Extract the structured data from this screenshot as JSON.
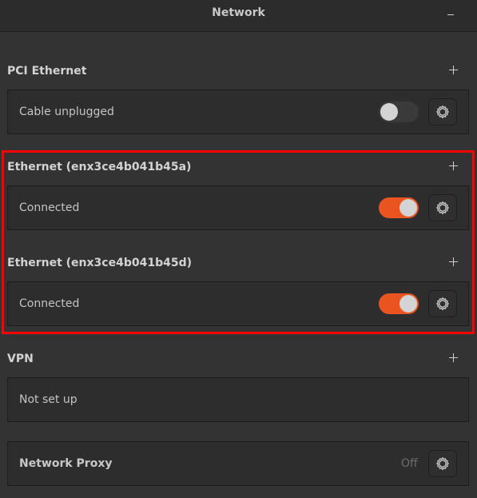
{
  "window": {
    "title": "Network",
    "minimize_icon": "minimize-icon"
  },
  "sections": [
    {
      "title": "PCI Ethernet",
      "add_icon": "plus-icon",
      "row": {
        "label": "Cable unplugged",
        "switch_on": false,
        "settings_icon": "gear-icon"
      }
    },
    {
      "title": "Ethernet (enx3ce4b041b45a)",
      "add_icon": "plus-icon",
      "row": {
        "label": "Connected",
        "switch_on": true,
        "settings_icon": "gear-icon"
      }
    },
    {
      "title": "Ethernet (enx3ce4b041b45d)",
      "add_icon": "plus-icon",
      "row": {
        "label": "Connected",
        "switch_on": true,
        "settings_icon": "gear-icon"
      }
    },
    {
      "title": "VPN",
      "add_icon": "plus-icon",
      "row": {
        "label": "Not set up"
      }
    }
  ],
  "proxy": {
    "label": "Network Proxy",
    "status": "Off",
    "settings_icon": "gear-icon"
  },
  "colors": {
    "accent": "#e95420",
    "highlight_border": "#ff0000",
    "background": "#333333",
    "card": "#2d2d2d"
  }
}
